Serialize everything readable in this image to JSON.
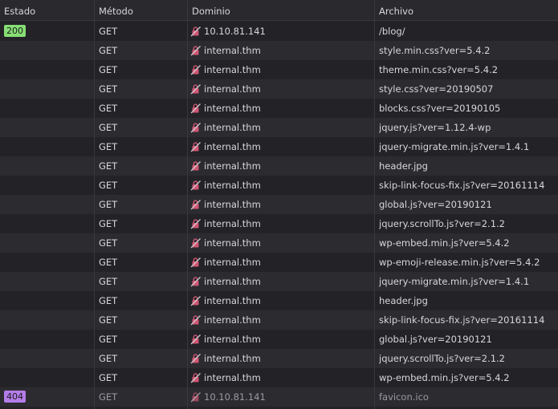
{
  "headers": {
    "status": "Estado",
    "method": "Método",
    "domain": "Dominio",
    "file": "Archivo"
  },
  "colors": {
    "ok_badge": "#86de74",
    "notfound_badge": "#b47ce8",
    "insecure_icon": "#e25c7c"
  },
  "rows": [
    {
      "status": "200",
      "method": "GET",
      "domain": "10.10.81.141",
      "file": "/blog/"
    },
    {
      "status": "",
      "method": "GET",
      "domain": "internal.thm",
      "file": "style.min.css?ver=5.4.2"
    },
    {
      "status": "",
      "method": "GET",
      "domain": "internal.thm",
      "file": "theme.min.css?ver=5.4.2"
    },
    {
      "status": "",
      "method": "GET",
      "domain": "internal.thm",
      "file": "style.css?ver=20190507"
    },
    {
      "status": "",
      "method": "GET",
      "domain": "internal.thm",
      "file": "blocks.css?ver=20190105"
    },
    {
      "status": "",
      "method": "GET",
      "domain": "internal.thm",
      "file": "jquery.js?ver=1.12.4-wp"
    },
    {
      "status": "",
      "method": "GET",
      "domain": "internal.thm",
      "file": "jquery-migrate.min.js?ver=1.4.1"
    },
    {
      "status": "",
      "method": "GET",
      "domain": "internal.thm",
      "file": "header.jpg"
    },
    {
      "status": "",
      "method": "GET",
      "domain": "internal.thm",
      "file": "skip-link-focus-fix.js?ver=20161114"
    },
    {
      "status": "",
      "method": "GET",
      "domain": "internal.thm",
      "file": "global.js?ver=20190121"
    },
    {
      "status": "",
      "method": "GET",
      "domain": "internal.thm",
      "file": "jquery.scrollTo.js?ver=2.1.2"
    },
    {
      "status": "",
      "method": "GET",
      "domain": "internal.thm",
      "file": "wp-embed.min.js?ver=5.4.2"
    },
    {
      "status": "",
      "method": "GET",
      "domain": "internal.thm",
      "file": "wp-emoji-release.min.js?ver=5.4.2"
    },
    {
      "status": "",
      "method": "GET",
      "domain": "internal.thm",
      "file": "jquery-migrate.min.js?ver=1.4.1"
    },
    {
      "status": "",
      "method": "GET",
      "domain": "internal.thm",
      "file": "header.jpg"
    },
    {
      "status": "",
      "method": "GET",
      "domain": "internal.thm",
      "file": "skip-link-focus-fix.js?ver=20161114"
    },
    {
      "status": "",
      "method": "GET",
      "domain": "internal.thm",
      "file": "global.js?ver=20190121"
    },
    {
      "status": "",
      "method": "GET",
      "domain": "internal.thm",
      "file": "jquery.scrollTo.js?ver=2.1.2"
    },
    {
      "status": "",
      "method": "GET",
      "domain": "internal.thm",
      "file": "wp-embed.min.js?ver=5.4.2"
    },
    {
      "status": "404",
      "method": "GET",
      "domain": "10.10.81.141",
      "file": "favicon.ico"
    }
  ]
}
